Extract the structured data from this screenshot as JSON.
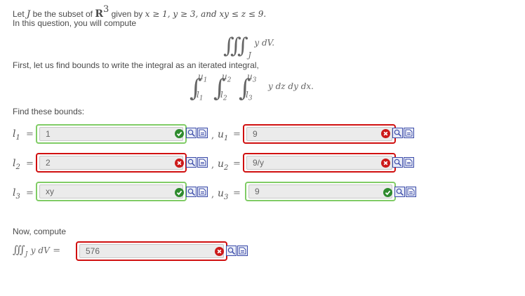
{
  "intro": {
    "line1_prefix": "Let",
    "set_name": "J",
    "line1_mid": "be the subset of",
    "space_R": "R",
    "space_exp": "3",
    "line1_given": "given by",
    "condition": "x ≥ 1, y ≥ 3, and xy ≤ z ≤ 9.",
    "line2": "In this question, you will compute"
  },
  "integral": {
    "signs": "∭",
    "region": "J",
    "integrand": "y dV."
  },
  "first_text": "First, let us find bounds to write the integral as an iterated integral,",
  "iterated": {
    "u1": "u",
    "u1_sub": "1",
    "l1": "l",
    "l1_sub": "1",
    "u2": "u",
    "u2_sub": "2",
    "l2": "l",
    "l2_sub": "2",
    "u3": "u",
    "u3_sub": "3",
    "l3": "l",
    "l3_sub": "3",
    "integrand": "y dz dy dx."
  },
  "find_text": "Find these bounds:",
  "bounds": [
    {
      "label": "l",
      "sub": "1",
      "value": "1",
      "status": "ok"
    },
    {
      "label": "u",
      "sub": "1",
      "value": "9",
      "status": "bad"
    },
    {
      "label": "l",
      "sub": "2",
      "value": "2",
      "status": "bad"
    },
    {
      "label": "u",
      "sub": "2",
      "value": "9/y",
      "status": "bad"
    },
    {
      "label": "l",
      "sub": "3",
      "value": "xy",
      "status": "ok"
    },
    {
      "label": "u",
      "sub": "3",
      "value": "9",
      "status": "ok"
    }
  ],
  "equals": "=",
  "comma": ",",
  "now_text": "Now, compute",
  "final": {
    "signs": "∭",
    "region": "J",
    "integrand": "y dV",
    "value": "576",
    "status": "bad"
  },
  "colors": {
    "ok_border": "#80cc66",
    "bad_border": "#d01010",
    "ok_icon": "#2e8b2e",
    "bad_icon": "#cc1a1a"
  },
  "icons": [
    "check-icon",
    "cross-icon",
    "preview-icon",
    "syntax-help-icon"
  ]
}
